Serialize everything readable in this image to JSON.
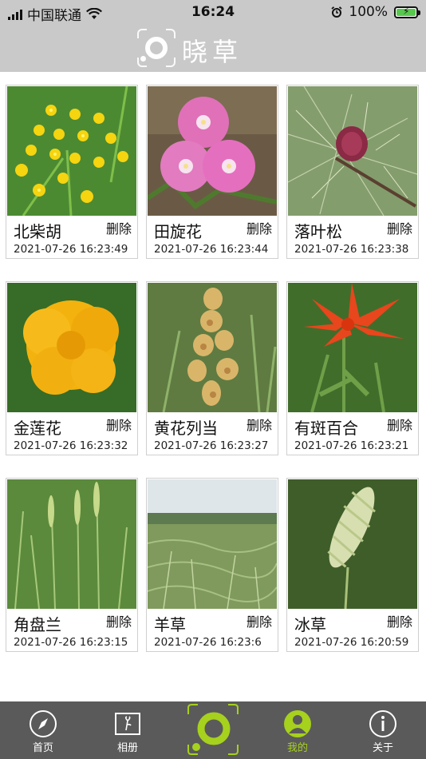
{
  "status_bar": {
    "carrier": "中国联通",
    "time": "16:24",
    "battery": "100%"
  },
  "header": {
    "app_title": "晓草"
  },
  "items": [
    {
      "name": "北柴胡",
      "delete_label": "删除",
      "timestamp": "2021-07-26 16:23:49"
    },
    {
      "name": "田旋花",
      "delete_label": "删除",
      "timestamp": "2021-07-26 16:23:44"
    },
    {
      "name": "落叶松",
      "delete_label": "删除",
      "timestamp": "2021-07-26 16:23:38"
    },
    {
      "name": "金莲花",
      "delete_label": "删除",
      "timestamp": "2021-07-26 16:23:32"
    },
    {
      "name": "黄花列当",
      "delete_label": "删除",
      "timestamp": "2021-07-26 16:23:27"
    },
    {
      "name": "有斑百合",
      "delete_label": "删除",
      "timestamp": "2021-07-26 16:23:21"
    },
    {
      "name": "角盘兰",
      "delete_label": "删除",
      "timestamp": "2021-07-26 16:23:15"
    },
    {
      "name": "羊草",
      "delete_label": "删除",
      "timestamp": "2021-07-26 16:23:6"
    },
    {
      "name": "冰草",
      "delete_label": "删除",
      "timestamp": "2021-07-26 16:20:59"
    }
  ],
  "tab_bar": {
    "tabs": [
      {
        "label": "首页",
        "icon": "compass-icon"
      },
      {
        "label": "相册",
        "icon": "photo-album-icon"
      },
      {
        "label": "",
        "icon": "camera-scan-icon"
      },
      {
        "label": "我的",
        "icon": "user-icon",
        "active": true
      },
      {
        "label": "关于",
        "icon": "info-icon"
      }
    ],
    "active_color": "#a6d11d"
  }
}
